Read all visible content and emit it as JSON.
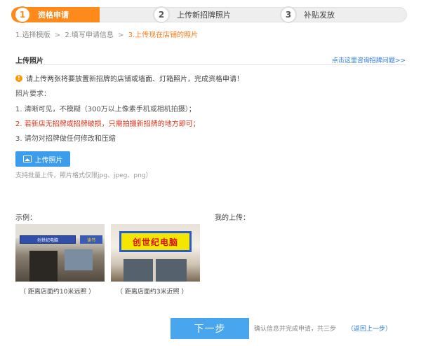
{
  "steps": [
    {
      "num": "1",
      "label": "资格申请",
      "active": true
    },
    {
      "num": "2",
      "label": "上传新招牌照片",
      "active": false
    },
    {
      "num": "3",
      "label": "补贴发放",
      "active": false
    }
  ],
  "breadcrumb": {
    "item1": "1.选择模版",
    "item2": "2.填写申请信息",
    "item3": "3.上传现在店铺的照片",
    "separator": ">"
  },
  "section": {
    "title": "上传照片",
    "help_link": "点击这里咨询招牌问题>>"
  },
  "notice": {
    "icon": "!",
    "text": "请上传两张将要放置新招牌的店铺或墙面、灯箱照片，完成资格申请！"
  },
  "requirements": {
    "heading": "照片要求：",
    "items": [
      "1. 清晰可见，不模糊（300万以上像素手机或相机拍摄）；",
      "2. 若新店无招牌或招牌破损，只需拍摄新招牌的地方即可；",
      "3. 请勿对招牌做任何修改和压缩"
    ]
  },
  "upload": {
    "button_label": "上传照片",
    "hint": "支持批量上传，照片格式仅限jpg、jpeg、png）"
  },
  "examples": {
    "label": "示例：",
    "mine_label": "我的上传：",
    "photo1_sign": "创世纪电脑",
    "photo1_sign2": "读书",
    "photo2_sign": "创世纪电脑",
    "caption1": "（ 距离店面约10米远照 ）",
    "caption2": "（ 距离店面约3米近照 ）"
  },
  "footer": {
    "next_button": "下一步",
    "confirm_text": "确认信息并完成申请，共三步",
    "back_link": "（返回上一步）"
  },
  "colors": {
    "accent_orange": "#ff8a1c",
    "button_blue": "#47a6ee",
    "link_blue": "#2a7ad8",
    "warning_red": "#e5331b"
  }
}
